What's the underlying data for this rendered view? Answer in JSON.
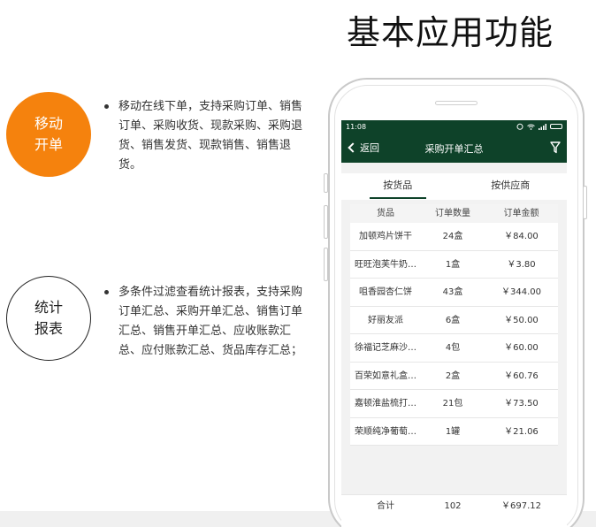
{
  "headline": "基本应用功能",
  "features": [
    {
      "circle_line1": "移动",
      "circle_line2": "开单",
      "description": "移动在线下单，支持采购订单、销售订单、采购收货、现款采购、采购退货、销售发货、现款销售、销售退货。"
    },
    {
      "circle_line1": "统计",
      "circle_line2": "报表",
      "description": "多条件过滤查看统计报表，支持采购订单汇总、采购开单汇总、销售订单汇总、销售开单汇总、应收账款汇总、应付账款汇总、货品库存汇总；"
    }
  ],
  "phone": {
    "status_time": "11:08",
    "back_label": "返回",
    "nav_title": "采购开单汇总",
    "tabs": [
      "按货品",
      "按供应商"
    ],
    "columns": [
      "货品",
      "订单数量",
      "订单金额"
    ],
    "rows": [
      {
        "name": "加顿鸡片饼干",
        "qty": "24盒",
        "amount": "￥84.00"
      },
      {
        "name": "旺旺泡芙牛奶…",
        "qty": "1盒",
        "amount": "￥3.80"
      },
      {
        "name": "咀香园杏仁饼",
        "qty": "43盒",
        "amount": "￥344.00"
      },
      {
        "name": "好丽友派",
        "qty": "6盒",
        "amount": "￥50.00"
      },
      {
        "name": "徐福记芝麻沙…",
        "qty": "4包",
        "amount": "￥60.00"
      },
      {
        "name": "百荣如意礼盒…",
        "qty": "2盒",
        "amount": "￥60.76"
      },
      {
        "name": "嘉顿淮盐梳打…",
        "qty": "21包",
        "amount": "￥73.50"
      },
      {
        "name": "荣顺纯净葡萄…",
        "qty": "1罐",
        "amount": "￥21.06"
      }
    ],
    "total": {
      "label": "合计",
      "qty": "102",
      "amount": "￥697.12"
    }
  },
  "colors": {
    "brand_green": "#0e4229",
    "accent_orange": "#f5820d"
  },
  "icons": [
    "back-chevron-icon",
    "filter-icon",
    "wifi-icon",
    "battery-icon",
    "alarm-icon"
  ]
}
